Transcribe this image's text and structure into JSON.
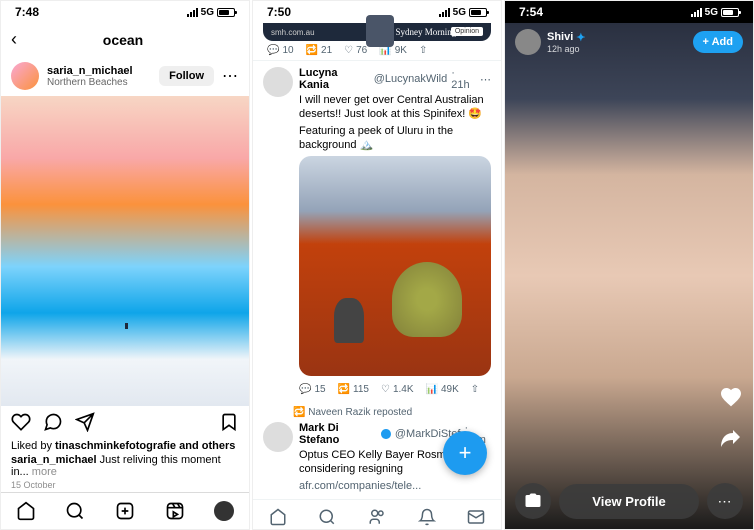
{
  "instagram": {
    "status": {
      "time": "7:48",
      "network": "5G"
    },
    "header": {
      "title": "ocean"
    },
    "post": {
      "username": "saria_n_michael",
      "location": "Northern Beaches",
      "follow_label": "Follow",
      "likes_prefix": "Liked by ",
      "likes_user": "tinaschminkefotografie",
      "likes_suffix": " and others",
      "caption_user": "saria_n_michael",
      "caption_text": " Just reliving this moment in...",
      "more_label": " more",
      "date": "15 October"
    }
  },
  "twitter": {
    "status": {
      "time": "7:50",
      "network": "5G"
    },
    "card": {
      "url": "smh.com.au",
      "publisher": "The Sydney Morning Herald",
      "opinion_label": "Opinion"
    },
    "card_metrics": {
      "reply": "10",
      "retweet": "21",
      "like": "76",
      "views": "9K"
    },
    "tweet": {
      "name": "Lucyna Kania",
      "handle": "@LucynakWild",
      "time": "· 21h",
      "text_line1": "I will never get over Central Australian deserts!! Just look at this Spinifex! 🤩",
      "text_line2": "Featuring a peek of Uluru in the background 🏔️"
    },
    "tweet_metrics": {
      "reply": "15",
      "retweet": "115",
      "like": "1.4K",
      "views": "49K"
    },
    "repost_label": "Naveen Razik reposted",
    "bottom_tweet": {
      "name": "Mark Di Stefano",
      "handle": "@MarkDiStef",
      "time": "· 55m",
      "text": "Optus CEO Kelly Bayer Rosmarin is considering resigning",
      "link": "afr.com/companies/tele..."
    }
  },
  "snapchat": {
    "status": {
      "time": "7:54",
      "network": "5G"
    },
    "user": {
      "name": "Shivi",
      "time": "12h ago"
    },
    "add_label": "+ Add",
    "view_profile_label": "View Profile"
  }
}
